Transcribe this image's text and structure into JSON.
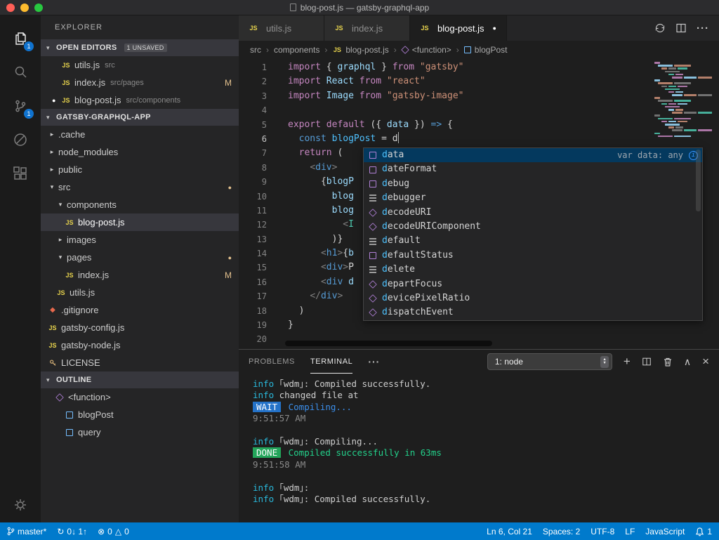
{
  "window": {
    "title": "blog-post.js — gatsby-graphql-app"
  },
  "activity_bar": {
    "explorer_badge": "1",
    "scm_badge": "1"
  },
  "sidebar": {
    "title": "EXPLORER",
    "open_editors": {
      "label": "OPEN EDITORS",
      "badge": "1 UNSAVED",
      "items": [
        {
          "name": "utils.js",
          "path": "src",
          "dirty": false,
          "modified": ""
        },
        {
          "name": "index.js",
          "path": "src/pages",
          "dirty": false,
          "modified": "M"
        },
        {
          "name": "blog-post.js",
          "path": "src/components",
          "dirty": true,
          "modified": ""
        }
      ]
    },
    "tree": {
      "root": "GATSBY-GRAPHQL-APP",
      "items": [
        {
          "label": ".cache",
          "kind": "folder",
          "indent": 0,
          "expanded": false
        },
        {
          "label": "node_modules",
          "kind": "folder",
          "indent": 0,
          "expanded": false
        },
        {
          "label": "public",
          "kind": "folder",
          "indent": 0,
          "expanded": false
        },
        {
          "label": "src",
          "kind": "folder",
          "indent": 0,
          "expanded": true,
          "dot": true
        },
        {
          "label": "components",
          "kind": "folder",
          "indent": 1,
          "expanded": true
        },
        {
          "label": "blog-post.js",
          "kind": "js",
          "indent": 2,
          "selected": true
        },
        {
          "label": "images",
          "kind": "folder",
          "indent": 1,
          "expanded": false
        },
        {
          "label": "pages",
          "kind": "folder",
          "indent": 1,
          "expanded": true,
          "dot": true
        },
        {
          "label": "index.js",
          "kind": "js",
          "indent": 2,
          "modified": "M"
        },
        {
          "label": "utils.js",
          "kind": "js",
          "indent": 1
        },
        {
          "label": ".gitignore",
          "kind": "git",
          "indent": 0
        },
        {
          "label": "gatsby-config.js",
          "kind": "js",
          "indent": 0
        },
        {
          "label": "gatsby-node.js",
          "kind": "js",
          "indent": 0
        },
        {
          "label": "LICENSE",
          "kind": "license",
          "indent": 0
        }
      ]
    },
    "outline": {
      "label": "OUTLINE",
      "items": [
        {
          "label": "<function>",
          "kind": "function",
          "indent": 0
        },
        {
          "label": "blogPost",
          "kind": "symbol",
          "indent": 1
        },
        {
          "label": "query",
          "kind": "symbol",
          "indent": 1
        }
      ]
    }
  },
  "tabs": [
    {
      "label": "utils.js",
      "active": false,
      "dirty": false
    },
    {
      "label": "index.js",
      "active": false,
      "dirty": false
    },
    {
      "label": "blog-post.js",
      "active": true,
      "dirty": true
    }
  ],
  "breadcrumb": [
    {
      "label": "src",
      "icon": ""
    },
    {
      "label": "components",
      "icon": ""
    },
    {
      "label": "blog-post.js",
      "icon": "js"
    },
    {
      "label": "<function>",
      "icon": "function"
    },
    {
      "label": "blogPost",
      "icon": "symbol"
    }
  ],
  "editor": {
    "active_line": 6,
    "lines": [
      {
        "n": 1,
        "t": [
          [
            "import",
            "kw"
          ],
          [
            " { ",
            "pl"
          ],
          [
            "graphql",
            "id"
          ],
          [
            " } ",
            "pl"
          ],
          [
            "from",
            "kw"
          ],
          [
            " ",
            "pl"
          ],
          [
            "\"gatsby\"",
            "st"
          ]
        ]
      },
      {
        "n": 2,
        "t": [
          [
            "import",
            "kw"
          ],
          [
            " ",
            "pl"
          ],
          [
            "React",
            "id"
          ],
          [
            " ",
            "pl"
          ],
          [
            "from",
            "kw"
          ],
          [
            " ",
            "pl"
          ],
          [
            "\"react\"",
            "st"
          ]
        ]
      },
      {
        "n": 3,
        "t": [
          [
            "import",
            "kw"
          ],
          [
            " ",
            "pl"
          ],
          [
            "Image",
            "id"
          ],
          [
            " ",
            "pl"
          ],
          [
            "from",
            "kw"
          ],
          [
            " ",
            "pl"
          ],
          [
            "\"gatsby-image\"",
            "st"
          ]
        ]
      },
      {
        "n": 4,
        "t": []
      },
      {
        "n": 5,
        "t": [
          [
            "export",
            "kw"
          ],
          [
            " ",
            "pl"
          ],
          [
            "default",
            "kw"
          ],
          [
            " ({ ",
            "pl"
          ],
          [
            "data",
            "id"
          ],
          [
            " }) ",
            "pl"
          ],
          [
            "=>",
            "kw2"
          ],
          [
            " {",
            "pl"
          ]
        ]
      },
      {
        "n": 6,
        "cursor": true,
        "t": [
          [
            "  ",
            "pl"
          ],
          [
            "const",
            "kw2"
          ],
          [
            " ",
            "pl"
          ],
          [
            "blogPost",
            "id2"
          ],
          [
            " = ",
            "pl"
          ],
          [
            "d",
            "pl"
          ]
        ]
      },
      {
        "n": 7,
        "t": [
          [
            "  ",
            "pl"
          ],
          [
            "return",
            "kw"
          ],
          [
            " (",
            "pl"
          ]
        ]
      },
      {
        "n": 8,
        "t": [
          [
            "    ",
            "pl"
          ],
          [
            "<",
            "br"
          ],
          [
            "div",
            "tg"
          ],
          [
            ">",
            "br"
          ]
        ]
      },
      {
        "n": 9,
        "t": [
          [
            "      {",
            "pl"
          ],
          [
            "blogP",
            "id"
          ]
        ]
      },
      {
        "n": 10,
        "t": [
          [
            "        ",
            "pl"
          ],
          [
            "blog",
            "id"
          ]
        ]
      },
      {
        "n": 11,
        "t": [
          [
            "        ",
            "pl"
          ],
          [
            "blog",
            "id"
          ]
        ]
      },
      {
        "n": 12,
        "t": [
          [
            "          ",
            "pl"
          ],
          [
            "<",
            "br"
          ],
          [
            "I",
            "cp"
          ]
        ]
      },
      {
        "n": 13,
        "t": [
          [
            "        )}",
            "pl"
          ]
        ]
      },
      {
        "n": 14,
        "t": [
          [
            "      ",
            "pl"
          ],
          [
            "<",
            "br"
          ],
          [
            "h1",
            "tg"
          ],
          [
            ">",
            "br"
          ],
          [
            "{",
            "pl"
          ],
          [
            "b",
            "id"
          ]
        ]
      },
      {
        "n": 15,
        "t": [
          [
            "      ",
            "pl"
          ],
          [
            "<",
            "br"
          ],
          [
            "div",
            "tg"
          ],
          [
            ">",
            "br"
          ],
          [
            "P",
            "pl"
          ]
        ]
      },
      {
        "n": 16,
        "t": [
          [
            "      ",
            "pl"
          ],
          [
            "<",
            "br"
          ],
          [
            "div",
            "tg"
          ],
          [
            " d",
            "id"
          ]
        ]
      },
      {
        "n": 17,
        "t": [
          [
            "    ",
            "pl"
          ],
          [
            "</",
            "br"
          ],
          [
            "div",
            "tg"
          ],
          [
            ">",
            "br"
          ]
        ]
      },
      {
        "n": 18,
        "t": [
          [
            "  )",
            "pl"
          ]
        ]
      },
      {
        "n": 19,
        "t": [
          [
            "}",
            "pl"
          ]
        ]
      },
      {
        "n": 20,
        "t": []
      }
    ]
  },
  "autocomplete": {
    "selected_detail": "var data: any",
    "items": [
      {
        "match": "d",
        "rest": "ata",
        "kind": "field",
        "selected": true
      },
      {
        "match": "d",
        "rest": "ateFormat",
        "kind": "field"
      },
      {
        "match": "d",
        "rest": "ebug",
        "kind": "field"
      },
      {
        "match": "d",
        "rest": "ebugger",
        "kind": "keyword"
      },
      {
        "match": "d",
        "rest": "ecodeURI",
        "kind": "function"
      },
      {
        "match": "d",
        "rest": "ecodeURIComponent",
        "kind": "function"
      },
      {
        "match": "d",
        "rest": "efault",
        "kind": "keyword"
      },
      {
        "match": "d",
        "rest": "efaultStatus",
        "kind": "field"
      },
      {
        "match": "d",
        "rest": "elete",
        "kind": "keyword"
      },
      {
        "match": "d",
        "rest": "epartFocus",
        "kind": "function"
      },
      {
        "match": "d",
        "rest": "evicePixelRatio",
        "kind": "function"
      },
      {
        "match": "d",
        "rest": "ispatchEvent",
        "kind": "function"
      }
    ]
  },
  "panel": {
    "problems_label": "PROBLEMS",
    "terminal_label": "TERMINAL",
    "select_value": "1: node"
  },
  "terminal": {
    "lines": [
      [
        [
          "info",
          "info"
        ],
        [
          " ｢wdm｣: Compiled successfully.",
          "pl"
        ]
      ],
      [
        [
          "info",
          "info"
        ],
        [
          " changed file at",
          "pl"
        ]
      ],
      [
        [
          "WAIT",
          "wait"
        ],
        [
          " Compiling...",
          "blue"
        ]
      ],
      [
        [
          "9:51:57 AM",
          "dim"
        ]
      ],
      [],
      [
        [
          "info",
          "info"
        ],
        [
          " ｢wdm｣: Compiling...",
          "pl"
        ]
      ],
      [
        [
          "DONE",
          "done"
        ],
        [
          " Compiled successfully in 63ms",
          "green"
        ]
      ],
      [
        [
          "9:51:58 AM",
          "dim"
        ]
      ],
      [],
      [
        [
          "info",
          "info"
        ],
        [
          " ｢wdm｣:",
          "pl"
        ]
      ],
      [
        [
          "info",
          "info"
        ],
        [
          " ｢wdm｣: Compiled successfully.",
          "pl"
        ]
      ]
    ]
  },
  "status_bar": {
    "branch": "master*",
    "sync": "0↓ 1↑",
    "errors": "0",
    "warnings": "0",
    "line_col": "Ln 6, Col 21",
    "spaces": "Spaces: 2",
    "encoding": "UTF-8",
    "eol": "LF",
    "language": "JavaScript",
    "notifications": "1"
  }
}
